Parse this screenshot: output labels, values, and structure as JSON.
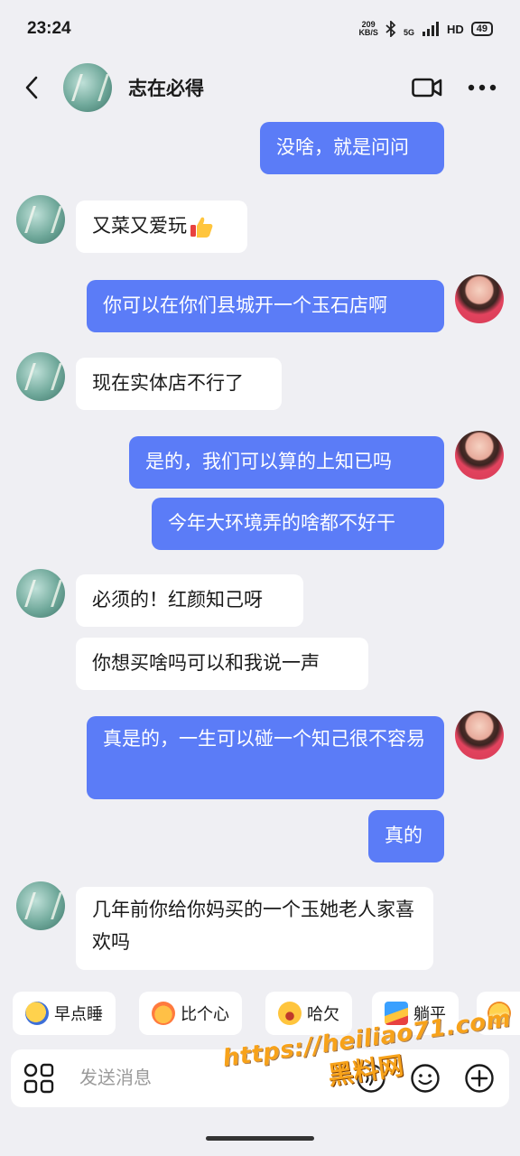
{
  "status": {
    "time": "23:24",
    "speed_value": "209",
    "speed_unit": "KB/S",
    "network": "5G",
    "hd": "HD",
    "battery": "49"
  },
  "header": {
    "contact_name": "志在必得"
  },
  "messages": [
    {
      "from": "self",
      "text": "没啥，就是问问"
    },
    {
      "from": "friend",
      "text": "又菜又爱玩"
    },
    {
      "from": "self",
      "text": "你可以在你们县城开一个玉石店啊"
    },
    {
      "from": "friend",
      "text": "现在实体店不行了"
    },
    {
      "from": "self",
      "text": "是的，我们可以算的上知已吗"
    },
    {
      "from": "self",
      "text": "今年大环境弄的啥都不好干"
    },
    {
      "from": "friend",
      "text": "必须的！红颜知己呀"
    },
    {
      "from": "friend",
      "text": "你想买啥吗可以和我说一声"
    },
    {
      "from": "self",
      "text": "真是的，一生可以碰一个知己很不容易"
    },
    {
      "from": "self",
      "text": "真的"
    },
    {
      "from": "friend",
      "text": "几年前你给你妈买的一个玉她老人家喜欢吗"
    }
  ],
  "quick_replies": [
    {
      "label": "早点睡",
      "icon": "sleep-emoji-icon"
    },
    {
      "label": "比个心",
      "icon": "heart-gesture-emoji-icon"
    },
    {
      "label": "哈欠",
      "icon": "yawn-emoji-icon"
    },
    {
      "label": "躺平",
      "icon": "lie-flat-emoji-icon"
    }
  ],
  "input": {
    "placeholder": "发送消息"
  },
  "watermark": {
    "url": "https://heiliao71.com",
    "name": "黑料网"
  },
  "colors": {
    "background": "#efeff3",
    "outgoing_bubble": "#5b7cf7",
    "incoming_bubble": "#ffffff",
    "watermark": "#f7a21a"
  }
}
